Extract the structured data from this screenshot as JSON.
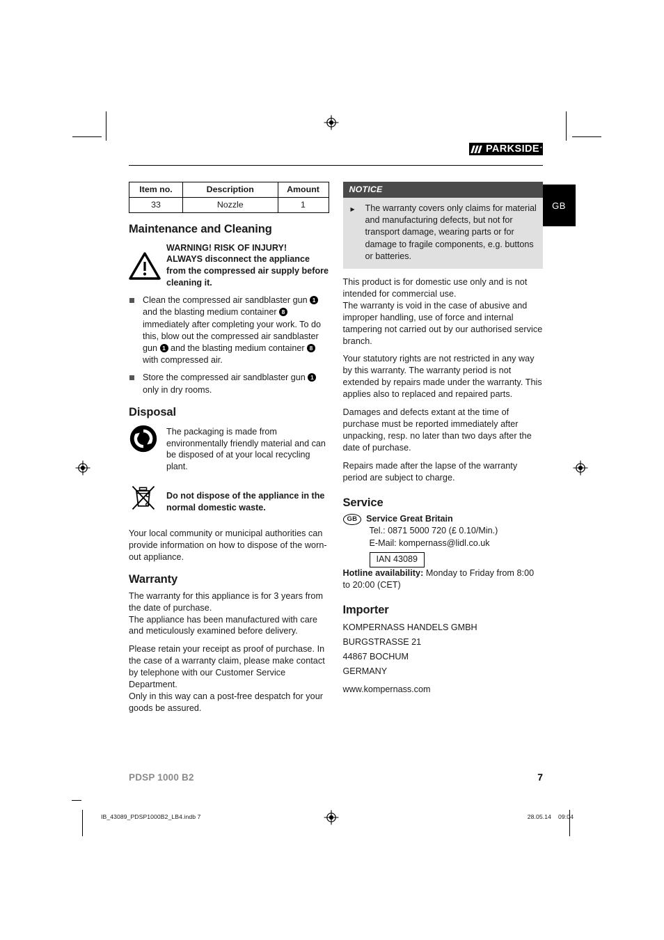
{
  "header": {
    "brand": "PARKSIDE",
    "brand_trademark": "*",
    "language_tab": "GB"
  },
  "parts_table": {
    "headers": [
      "Item no.",
      "Description",
      "Amount"
    ],
    "rows": [
      [
        "33",
        "Nozzle",
        "1"
      ]
    ]
  },
  "maintenance": {
    "heading": "Maintenance and Cleaning",
    "warning_title": "WARNING! RISK OF INJURY!",
    "warning_body": "ALWAYS disconnect the appliance from the compressed air supply before cleaning it.",
    "bullets": [
      {
        "p1": "Clean the compressed air sandblaster gun",
        "r1": "1",
        "p2": "and the blasting medium container",
        "r2": "8",
        "p3": "immediately after completing your work. To do this, blow out the compressed air sandblaster gun",
        "r3": "1",
        "p4": "and the blasting medium container",
        "r4": "8",
        "p5": "with compressed air."
      },
      {
        "p1": "Store the compressed air sandblaster gun",
        "r1": "1",
        "p2": "only in dry rooms."
      }
    ]
  },
  "disposal": {
    "heading": "Disposal",
    "recycle_text": "The packaging is made from environmentally friendly material and can be disposed of at your local recycling plant.",
    "weee_text": "Do not dispose of the appliance in the normal domestic waste.",
    "authority_text": "Your local community or municipal authorities can provide information on how to dispose of the worn-out appliance."
  },
  "warranty_left": {
    "heading": "Warranty",
    "paragraphs": [
      "The warranty for this appliance is for 3 years from the date of purchase.\nThe appliance has been manufactured with care and meticulously examined before delivery.",
      "Please retain your receipt as proof of purchase. In the case of a warranty claim, please make contact by telephone with our Customer Service Department.\nOnly in this way can a post-free despatch for your goods be assured."
    ]
  },
  "notice": {
    "title": "NOTICE",
    "item": "The warranty covers only claims for material and manufacturing defects, but not for transport damage, wearing parts or for damage to fragile components, e.g. buttons or batteries."
  },
  "warranty_right": {
    "paragraphs": [
      "This product is for domestic use only and is not intended for commercial use.\nThe warranty is void in the case of abusive and improper handling, use of force and internal tampering not carried out by our authorised service branch.",
      "Your statutory rights are not restricted in any way by this warranty. The warranty period is not extended by repairs made under the warranty. This applies also to replaced and repaired parts.",
      "Damages and defects extant at the time of purchase must be reported immediately after unpacking, resp. no later than two days after the date of purchase.",
      "Repairs made after the lapse of the warranty period are subject to charge."
    ]
  },
  "service": {
    "heading": "Service",
    "country_code": "GB",
    "country_name": "Service Great Britain",
    "tel": "Tel.: 0871 5000 720 (£ 0.10/Min.)",
    "email": "E-Mail: kompernass@lidl.co.uk",
    "ian": "IAN 43089",
    "hotline_label": "Hotline availability:",
    "hotline_value": "Monday to Friday from 8:00 to 20:00 (CET)"
  },
  "importer": {
    "heading": "Importer",
    "lines": [
      "KOMPERNASS HANDELS GMBH",
      "BURGSTRASSE 21",
      "44867 BOCHUM",
      "GERMANY"
    ],
    "website": "www.kompernass.com"
  },
  "footer": {
    "model": "PDSP 1000 B2",
    "page_number": "7",
    "print_file": "IB_43089_PDSP1000B2_LB4.indb   7",
    "print_date": "28.05.14",
    "print_time": "09:04"
  }
}
